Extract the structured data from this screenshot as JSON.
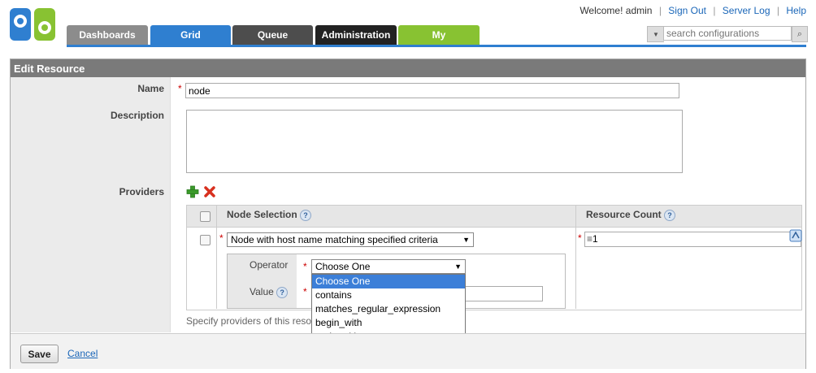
{
  "header": {
    "welcome": "Welcome! admin",
    "links": {
      "sign_out": "Sign Out",
      "server_log": "Server Log",
      "help": "Help"
    },
    "tabs": [
      "Dashboards",
      "Grid",
      "Queue",
      "Administration",
      "My"
    ],
    "search_placeholder": "search configurations"
  },
  "panel": {
    "title": "Edit Resource",
    "name_label": "Name",
    "name_value": "node",
    "description_label": "Description",
    "description_value": "",
    "providers_label": "Providers",
    "table": {
      "col_node_selection": "Node Selection",
      "col_resource_count": "Resource Count",
      "row": {
        "node_selection_value": "Node with host name matching specified criteria",
        "resource_count_value": "1",
        "operator_label": "Operator",
        "operator_value": "Choose One",
        "value_label": "Value"
      }
    },
    "dropdown_options": [
      "Choose One",
      "contains",
      "matches_regular_expression",
      "begin_with",
      "ends_with"
    ],
    "hint": "Specify providers of this reso"
  },
  "footer": {
    "save": "Save",
    "cancel": "Cancel"
  },
  "colors": {
    "grid_tab": "#2f7fd0",
    "my_tab": "#88c232",
    "admin_tab": "#222222",
    "selected_option": "#3c7fd8"
  }
}
